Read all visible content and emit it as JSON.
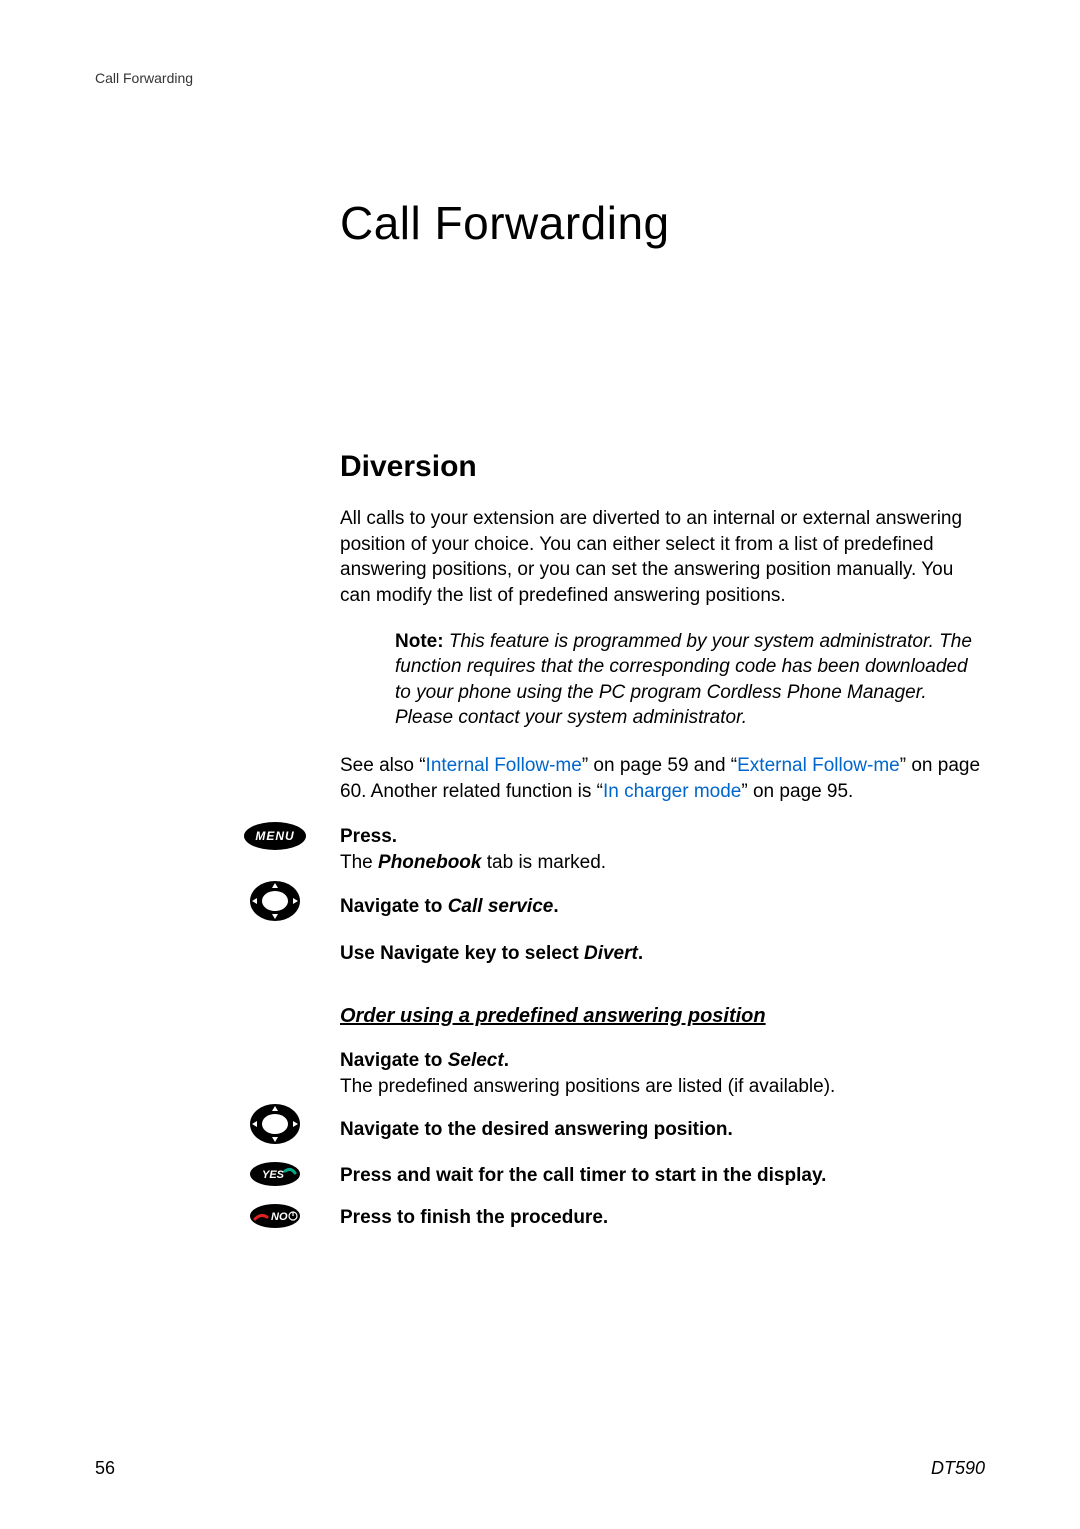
{
  "header": "Call Forwarding",
  "chapter_title": "Call Forwarding",
  "section_title": "Diversion",
  "intro": "All calls to your extension are diverted to an internal or external answering position of your choice. You can either select it from a list of predefined answering positions, or you can set the answering position manually. You can modify the list of predefined answering positions.",
  "note_label": "Note:",
  "note_body": "This feature is programmed by your system administrator. The function requires that the corresponding code has been downloaded to your phone using the PC program Cordless Phone Manager. Please contact your system administrator.",
  "see_also_pre": "See also “",
  "link1": "Internal Follow-me",
  "see_also_mid1": "” on page 59 and “",
  "link2": "External Follow-me",
  "see_also_mid2": "” on page 60. Another related function is “",
  "link3": "In charger mode",
  "see_also_post": "” on page 95.",
  "steps1": {
    "press": "Press.",
    "press_sub_pre": "The ",
    "press_sub_em": "Phonebook",
    "press_sub_post": " tab is marked.",
    "nav_pre": "Navigate to ",
    "nav_em": "Call service",
    "nav_post": ".",
    "use_pre": "Use Navigate key to select ",
    "use_em": "Divert",
    "use_post": "."
  },
  "subsection": "Order using a predefined answering position",
  "steps2": {
    "navsel_pre": "Navigate to ",
    "navsel_em": "Select",
    "navsel_post": ".",
    "navsel_sub": "The predefined answering positions are listed (if available).",
    "navpos": "Navigate to the desired answering position.",
    "yes": "Press and wait for the call timer to start in the display.",
    "no": "Press to finish the procedure."
  },
  "icons": {
    "menu": "MENU",
    "yes": "YES",
    "no": "NO"
  },
  "footer": {
    "page": "56",
    "model": "DT590"
  }
}
